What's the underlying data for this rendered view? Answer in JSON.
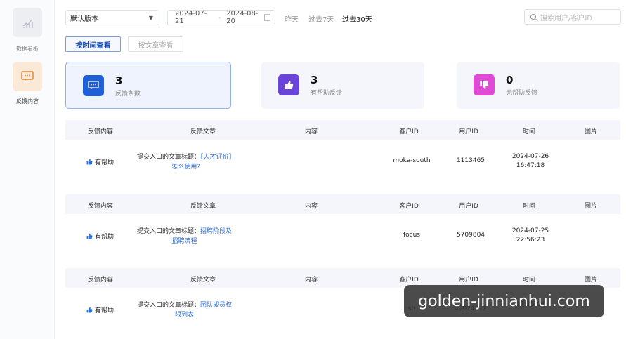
{
  "sidebar": {
    "items": [
      {
        "label": "数据看板",
        "icon": "bar-chart-icon"
      },
      {
        "label": "反馈内容",
        "icon": "feedback-message-icon"
      }
    ]
  },
  "toolbar": {
    "version_select": "默认版本",
    "date_start": "2024-07-21",
    "date_sep": "-",
    "date_end": "2024-08-20",
    "quick_ranges": [
      "昨天",
      "过去7天",
      "过去30天"
    ],
    "active_range": "过去30天",
    "search_placeholder": "搜索用户/客户ID"
  },
  "view_toggle": {
    "by_time": "按时间查看",
    "by_article": "按文章查看",
    "active": "按时间查看"
  },
  "stats": [
    {
      "value": "3",
      "label": "反馈条数",
      "color": "#1f5fd8",
      "icon": "message-icon"
    },
    {
      "value": "3",
      "label": "有帮助反馈",
      "color": "#6a43d8",
      "icon": "thumbs-up-icon"
    },
    {
      "value": "0",
      "label": "无帮助反馈",
      "color": "#e04ad6",
      "icon": "thumbs-down-icon"
    }
  ],
  "table": {
    "columns": [
      "反馈内容",
      "反馈文章",
      "内容",
      "客户ID",
      "用户ID",
      "时间",
      "图片"
    ],
    "rows": [
      {
        "feedback": "有帮助",
        "article_prefix": "提交入口的文章标题：",
        "article_line1": "【人才评价】",
        "article_line2": "怎么使用?",
        "content": "",
        "customer_id": "moka-south",
        "user_id": "1113465",
        "date": "2024-07-26",
        "time": "16:47:18"
      },
      {
        "feedback": "有帮助",
        "article_prefix": "提交入口的文章标题：",
        "article_line1": "招聘阶段及",
        "article_line2": "招聘流程",
        "content": "",
        "customer_id": "focus",
        "user_id": "5709804",
        "date": "2024-07-25",
        "time": "22:56:23"
      },
      {
        "feedback": "有帮助",
        "article_prefix": "提交入口的文章标题：",
        "article_line1": "团队成员权",
        "article_line2": "限列表",
        "content": "",
        "customer_id": "sh",
        "user_id": "41024312",
        "date": "",
        "time": "17:15:06"
      }
    ]
  },
  "watermark": "golden-jinnianhui.com"
}
